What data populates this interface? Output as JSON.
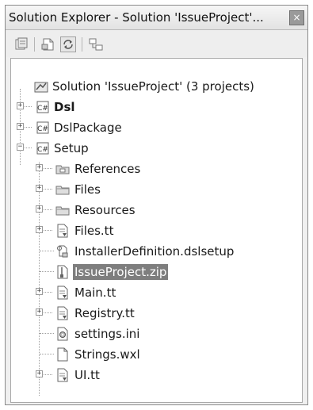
{
  "window": {
    "title": "Solution Explorer - Solution 'IssueProject'...",
    "close_glyph": "×"
  },
  "toolbar": {
    "buttons": [
      {
        "name": "properties-icon"
      },
      {
        "name": "show-all-files-icon"
      },
      {
        "name": "refresh-icon"
      },
      {
        "name": "view-class-diagram-icon"
      }
    ]
  },
  "tree": {
    "solution_label": "Solution 'IssueProject' (3 projects)",
    "dsl_label": "Dsl",
    "dslpackage_label": "DslPackage",
    "setup_label": "Setup",
    "setup_children": [
      {
        "label": "References",
        "icon": "references-icon",
        "expander": "+"
      },
      {
        "label": "Files",
        "icon": "folder-icon",
        "expander": "+"
      },
      {
        "label": "Resources",
        "icon": "folder-icon",
        "expander": "+"
      },
      {
        "label": "Files.tt",
        "icon": "text-template-icon",
        "expander": "+"
      },
      {
        "label": "InstallerDefinition.dslsetup",
        "icon": "dslsetup-file-icon",
        "expander": ""
      },
      {
        "label": "IssueProject.zip",
        "icon": "zip-file-icon",
        "expander": "",
        "selected": true
      },
      {
        "label": "Main.tt",
        "icon": "text-template-icon",
        "expander": "+"
      },
      {
        "label": "Registry.tt",
        "icon": "text-template-icon",
        "expander": "+"
      },
      {
        "label": "settings.ini",
        "icon": "settings-file-icon",
        "expander": ""
      },
      {
        "label": "Strings.wxl",
        "icon": "blank-file-icon",
        "expander": ""
      },
      {
        "label": "UI.tt",
        "icon": "text-template-icon",
        "expander": "+"
      }
    ],
    "expander_plus": "+",
    "expander_minus": "−"
  }
}
